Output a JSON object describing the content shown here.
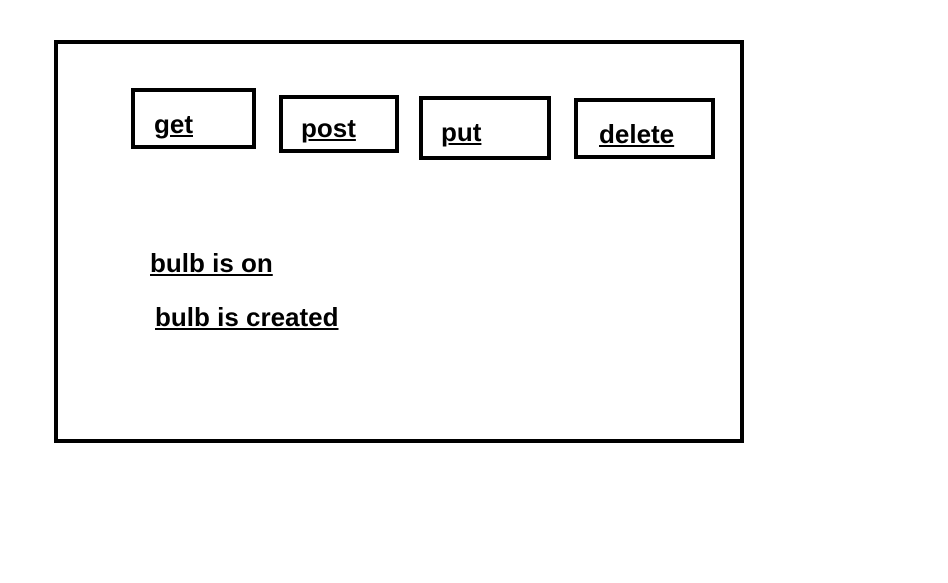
{
  "toolbar": {
    "buttons": [
      {
        "label": "get"
      },
      {
        "label": "post"
      },
      {
        "label": "put"
      },
      {
        "label": "delete"
      }
    ]
  },
  "status_messages": [
    "bulb is on",
    "bulb is created"
  ],
  "colors": {
    "border": "#000000",
    "background": "#ffffff",
    "text": "#000000"
  }
}
